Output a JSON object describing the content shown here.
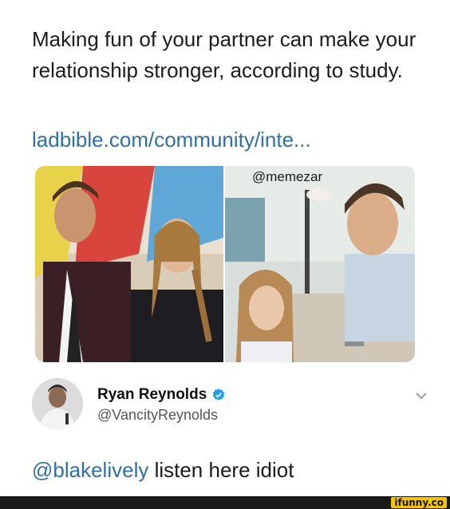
{
  "post": {
    "headline": "Making fun of your partner can make your relationship stronger, according to study.",
    "link_text": "ladbible.com/community/inte..."
  },
  "images": {
    "watermark": "@memezar"
  },
  "tweet": {
    "author_name": "Ryan Reynolds",
    "author_handle": "@VancityReynolds",
    "mention": "@blakelively",
    "text": " listen here idiot"
  },
  "footer": {
    "brand": "ifunny.co"
  },
  "colors": {
    "link": "#2f6fa8",
    "verified": "#1d9bf0",
    "brand": "#f5c400"
  },
  "icons": [
    "verified-badge-icon",
    "chevron-down-icon"
  ]
}
